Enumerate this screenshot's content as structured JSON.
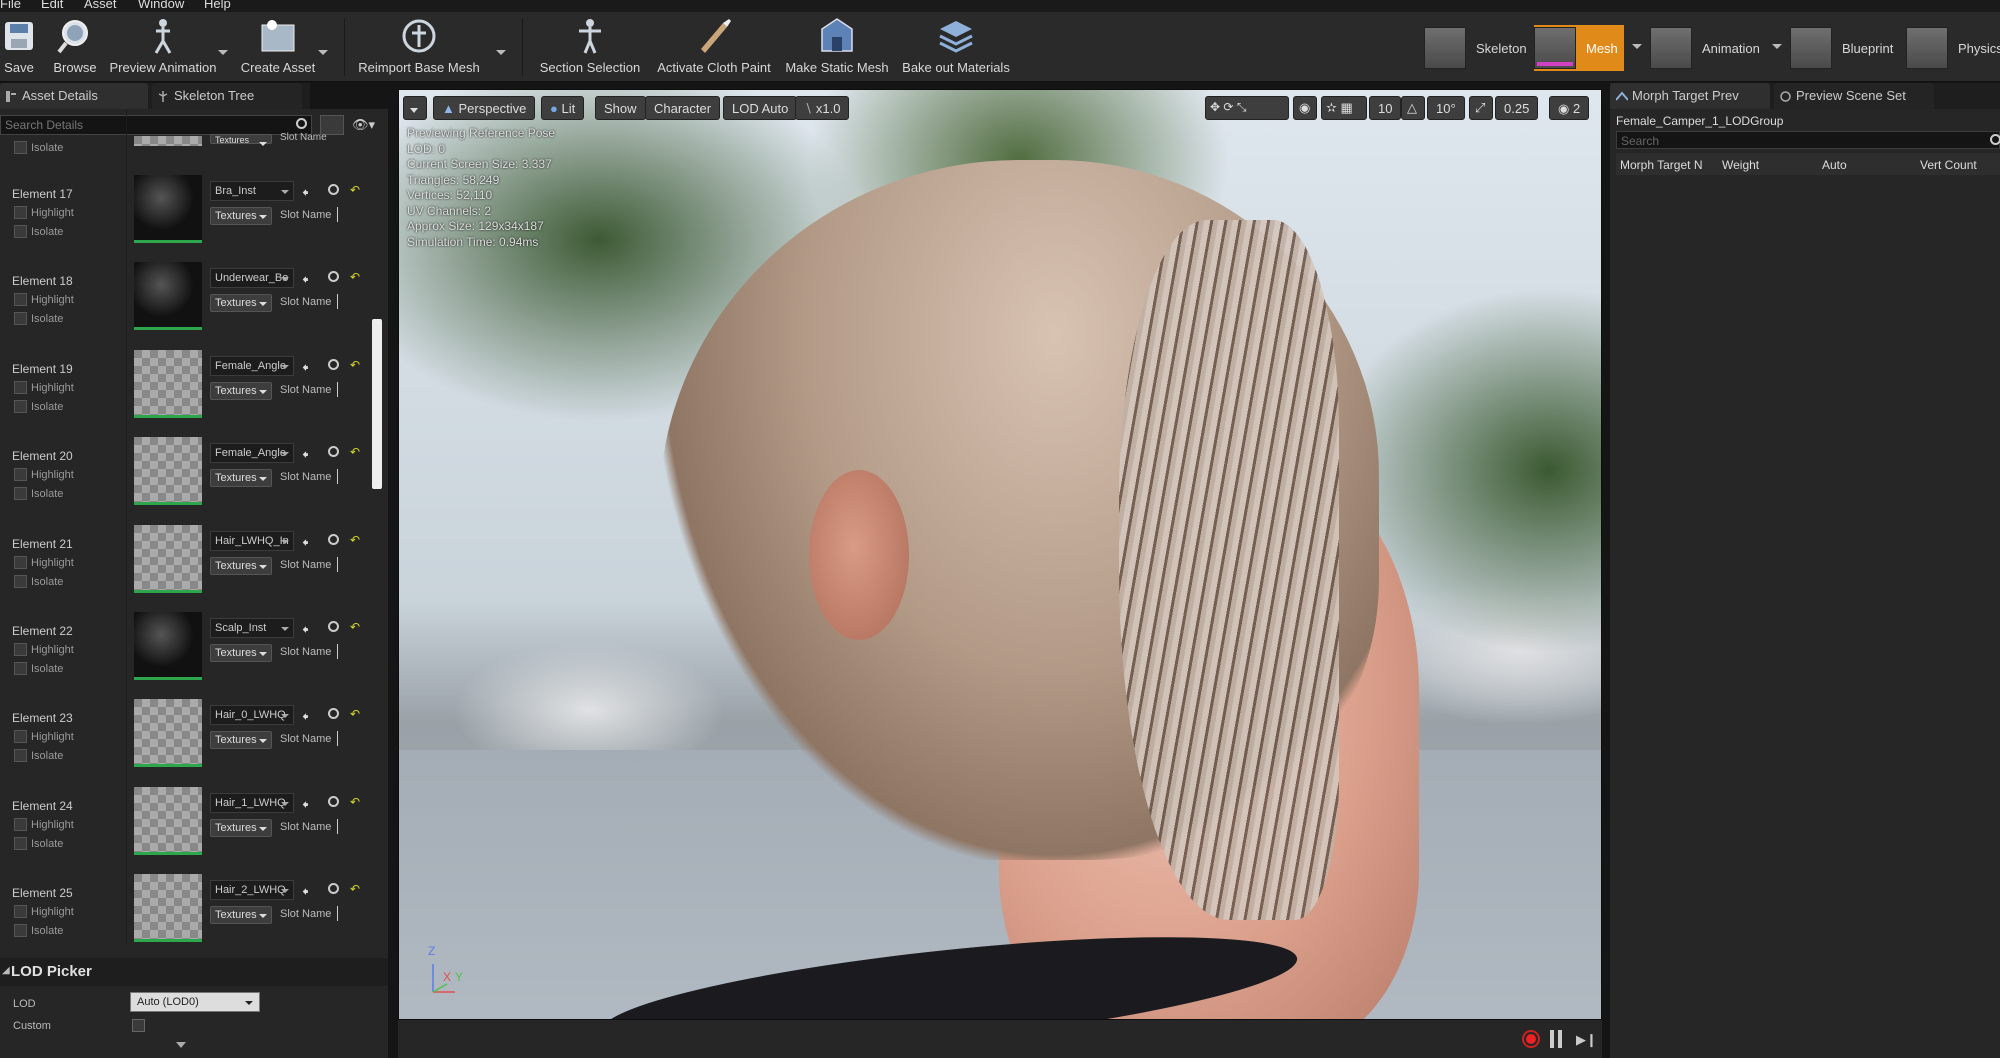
{
  "menu": [
    "File",
    "Edit",
    "Asset",
    "Window",
    "Help"
  ],
  "toolbar": {
    "buttons": [
      "Save",
      "Browse",
      "Preview Animation",
      "Create Asset",
      "Reimport Base Mesh",
      "Section Selection",
      "Activate Cloth Paint",
      "Make Static Mesh",
      "Bake out Materials"
    ],
    "modes": [
      "Skeleton",
      "Mesh",
      "Animation",
      "Blueprint",
      "Physics"
    ],
    "active_mode": "Mesh",
    "accent": "#e08a1a"
  },
  "left_tabs": [
    "Asset Details",
    "Skeleton Tree"
  ],
  "search": {
    "placeholder": "Search Details"
  },
  "top_partial": {
    "textures": "Textures",
    "slot": "Slot Name",
    "isolate": "Isolate"
  },
  "elements": [
    {
      "name": "Element 17",
      "material": "Bra_Inst",
      "highlight": "Highlight",
      "isolate": "Isolate",
      "textures": "Textures",
      "slot": "Slot Name"
    },
    {
      "name": "Element 18",
      "material": "Underwear_Bo",
      "highlight": "Highlight",
      "isolate": "Isolate",
      "textures": "Textures",
      "slot": "Slot Name"
    },
    {
      "name": "Element 19",
      "material": "Female_Angle",
      "highlight": "Highlight",
      "isolate": "Isolate",
      "textures": "Textures",
      "slot": "Slot Name"
    },
    {
      "name": "Element 20",
      "material": "Female_Angle",
      "highlight": "Highlight",
      "isolate": "Isolate",
      "textures": "Textures",
      "slot": "Slot Name"
    },
    {
      "name": "Element 21",
      "material": "Hair_LWHQ_In",
      "highlight": "Highlight",
      "isolate": "Isolate",
      "textures": "Textures",
      "slot": "Slot Name"
    },
    {
      "name": "Element 22",
      "material": "Scalp_Inst",
      "highlight": "Highlight",
      "isolate": "Isolate",
      "textures": "Textures",
      "slot": "Slot Name"
    },
    {
      "name": "Element 23",
      "material": "Hair_0_LWHQ",
      "highlight": "Highlight",
      "isolate": "Isolate",
      "textures": "Textures",
      "slot": "Slot Name"
    },
    {
      "name": "Element 24",
      "material": "Hair_1_LWHQ",
      "highlight": "Highlight",
      "isolate": "Isolate",
      "textures": "Textures",
      "slot": "Slot Name"
    },
    {
      "name": "Element 25",
      "material": "Hair_2_LWHQ",
      "highlight": "Highlight",
      "isolate": "Isolate",
      "textures": "Textures",
      "slot": "Slot Name"
    }
  ],
  "lod_picker": {
    "title": "LOD Picker",
    "lod_label": "LOD",
    "lod_value": "Auto (LOD0)",
    "custom_label": "Custom"
  },
  "viewport": {
    "menu_pills": [
      "Perspective",
      "Lit",
      "Show",
      "Character",
      "LOD Auto",
      "x1.0"
    ],
    "right_controls": [
      "10",
      "10°",
      "0.25",
      "2"
    ],
    "stats": [
      "Previewing Reference Pose",
      "LOD: 0",
      "Current Screen Size: 3.337",
      "Triangles: 58,249",
      "Vertices: 52,110",
      "UV Channels: 2",
      "Approx Size: 129x34x187",
      "Simulation Time: 0.94ms"
    ],
    "axes": [
      "Z",
      "X",
      "Y"
    ]
  },
  "right_tabs": [
    "Morph Target Prev",
    "Preview Scene Set"
  ],
  "morph": {
    "group": "Female_Camper_1_LODGroup",
    "search_placeholder": "Search",
    "columns": [
      "Morph Target N",
      "Weight",
      "Auto",
      "Vert Count"
    ]
  }
}
